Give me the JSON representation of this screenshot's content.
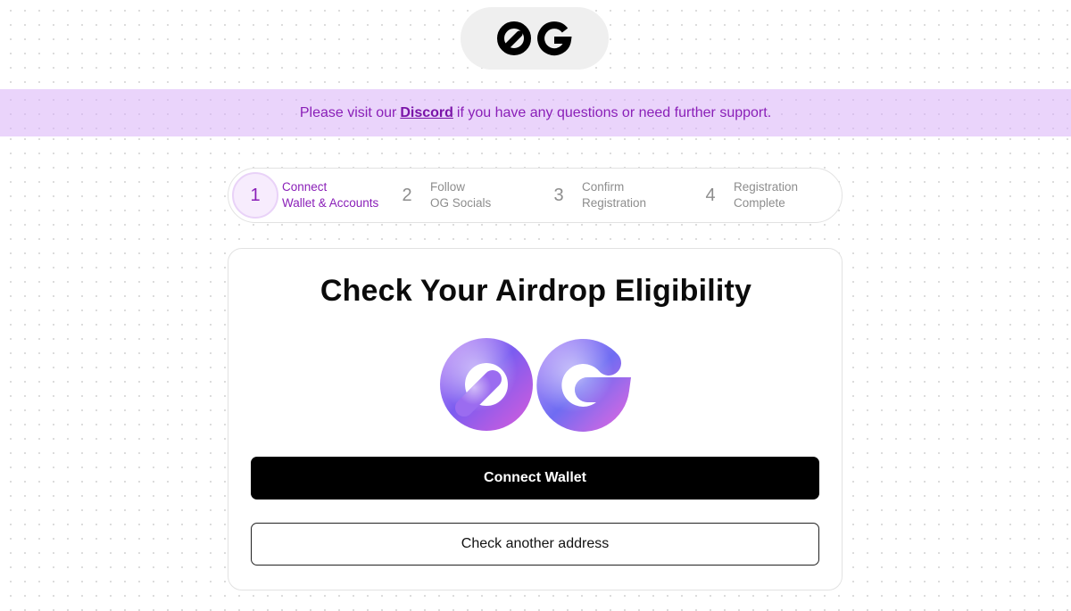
{
  "header": {
    "logo_icon": "og-logo-icon"
  },
  "banner": {
    "text_before": "Please visit our",
    "link_label": "Discord",
    "text_after": "if you have any questions or need further support.",
    "color": "#8a1fb8",
    "background": "#ead4fb"
  },
  "stepper": {
    "steps": [
      {
        "number": "1",
        "line1": "Connect",
        "line2": "Wallet & Accounts",
        "active": true
      },
      {
        "number": "2",
        "line1": "Follow",
        "line2": "OG Socials",
        "active": false
      },
      {
        "number": "3",
        "line1": "Confirm",
        "line2": "Registration",
        "active": false
      },
      {
        "number": "4",
        "line1": "Registration",
        "line2": "Complete",
        "active": false
      }
    ]
  },
  "card": {
    "title": "Check Your Airdrop Eligibility",
    "hero_icon": "og-3d-logo-icon",
    "connect_label": "Connect Wallet",
    "check_label": "Check another address"
  },
  "colors": {
    "accent": "#8a1fb8",
    "primary_button": "#000000"
  }
}
